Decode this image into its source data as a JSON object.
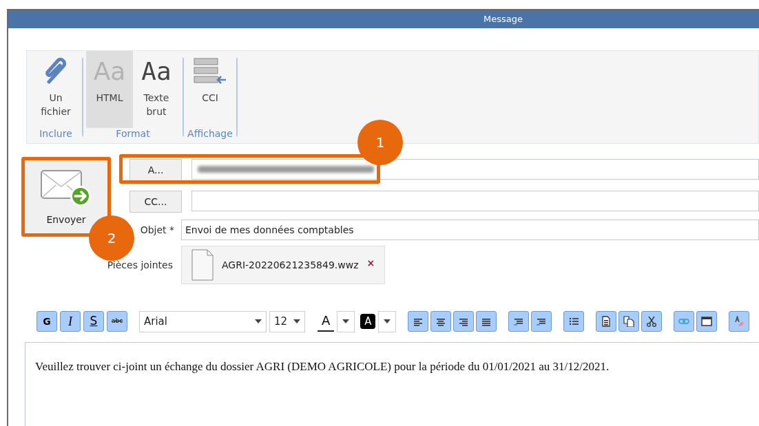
{
  "window": {
    "title": "Message"
  },
  "ribbon": {
    "groups": [
      {
        "label": "Inclure",
        "buttons": [
          {
            "kind": "clip",
            "lines": [
              "Un",
              "fichier"
            ],
            "selected": false
          }
        ]
      },
      {
        "label": "Format",
        "buttons": [
          {
            "kind": "html",
            "glyph": "Aa",
            "lines": [
              "HTML"
            ],
            "selected": true
          },
          {
            "kind": "plain",
            "glyph": "Aa",
            "lines": [
              "Texte",
              "brut"
            ],
            "selected": false
          }
        ]
      },
      {
        "label": "Affichage",
        "buttons": [
          {
            "kind": "bcc",
            "lines": [
              "CCI"
            ],
            "selected": false
          }
        ]
      }
    ]
  },
  "send_button": {
    "label": "Envoyer"
  },
  "recipients": [
    {
      "button": "A...",
      "redacted": true
    },
    {
      "button": "CC...",
      "redacted": false
    }
  ],
  "subject": {
    "label": "Objet *",
    "value": "Envoi de mes données comptables"
  },
  "attachments": {
    "label": "Pièces jointes",
    "files": [
      {
        "name": "AGRI-20220621235849.wwz",
        "remove": "×"
      }
    ]
  },
  "format_toolbar": {
    "style_buttons": [
      {
        "label": "G",
        "kind": "bold"
      },
      {
        "label": "I",
        "kind": "italic"
      },
      {
        "label": "S",
        "kind": "underline"
      },
      {
        "label": "abc",
        "kind": "strike"
      }
    ],
    "font": "Arial",
    "size": "12",
    "text_color": "A",
    "highlight": "A"
  },
  "body": "Veuillez trouver ci-joint un échange du dossier AGRI (DEMO AGRICOLE) pour la période du 01/01/2021 au 31/12/2021.",
  "callouts": [
    {
      "number": "1"
    },
    {
      "number": "2"
    }
  ]
}
